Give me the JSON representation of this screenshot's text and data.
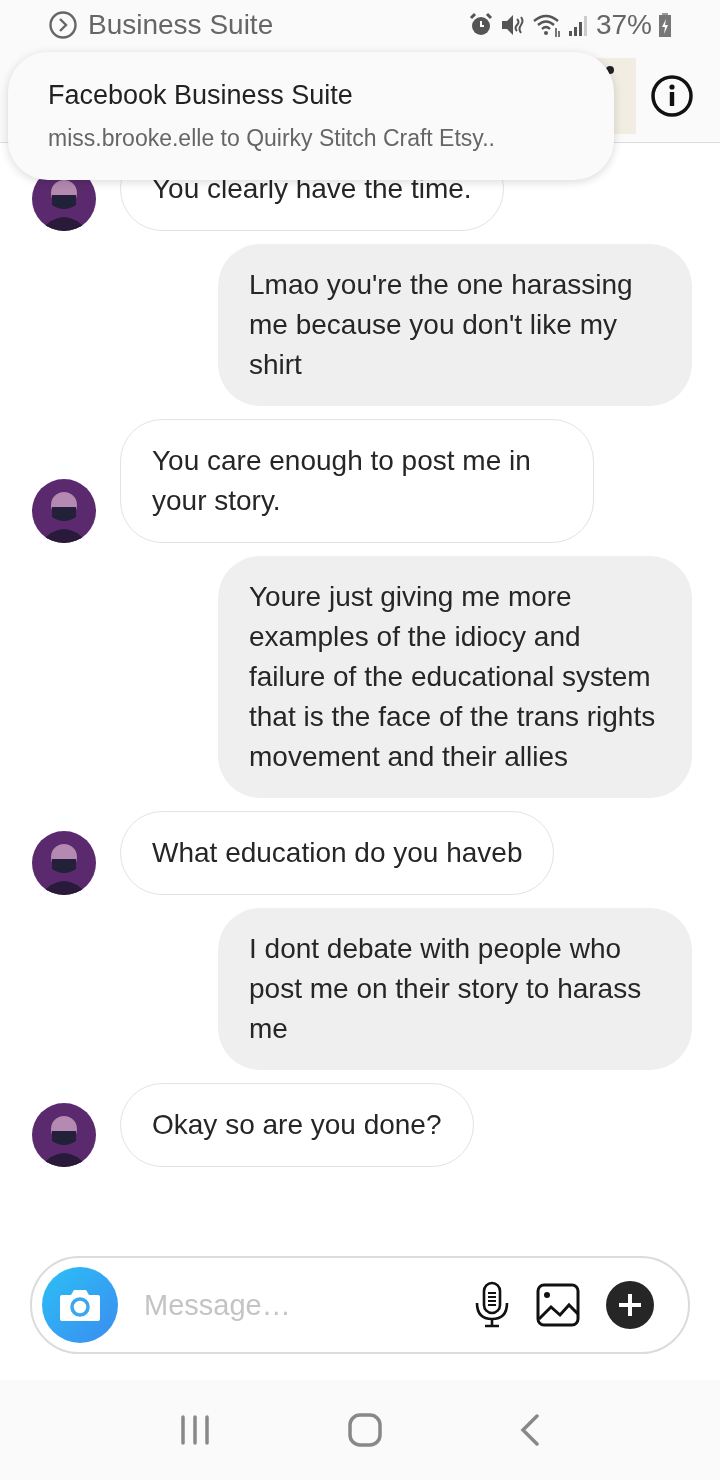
{
  "status_bar": {
    "app": "Business Suite",
    "battery": "37%"
  },
  "notification": {
    "title": "Facebook Business Suite",
    "text": "miss.brooke.elle to Quirky Stitch Craft Etsy.."
  },
  "messages": [
    {
      "kind": "incoming",
      "text": "You clearly have the time."
    },
    {
      "kind": "outgoing",
      "text": "Lmao you're the one harassing me because you don't like my shirt"
    },
    {
      "kind": "incoming",
      "text": "You care enough to post me in your story."
    },
    {
      "kind": "outgoing",
      "text": "Youre just giving me more examples of the idiocy and failure of the educational system that is the face of the trans rights movement and their allies"
    },
    {
      "kind": "incoming",
      "text": "What education do you haveb"
    },
    {
      "kind": "outgoing",
      "text": "I dont debate with people who post me on their story to harass me"
    },
    {
      "kind": "incoming",
      "text": "Okay so are you done?"
    }
  ],
  "composer": {
    "placeholder": "Message…"
  }
}
